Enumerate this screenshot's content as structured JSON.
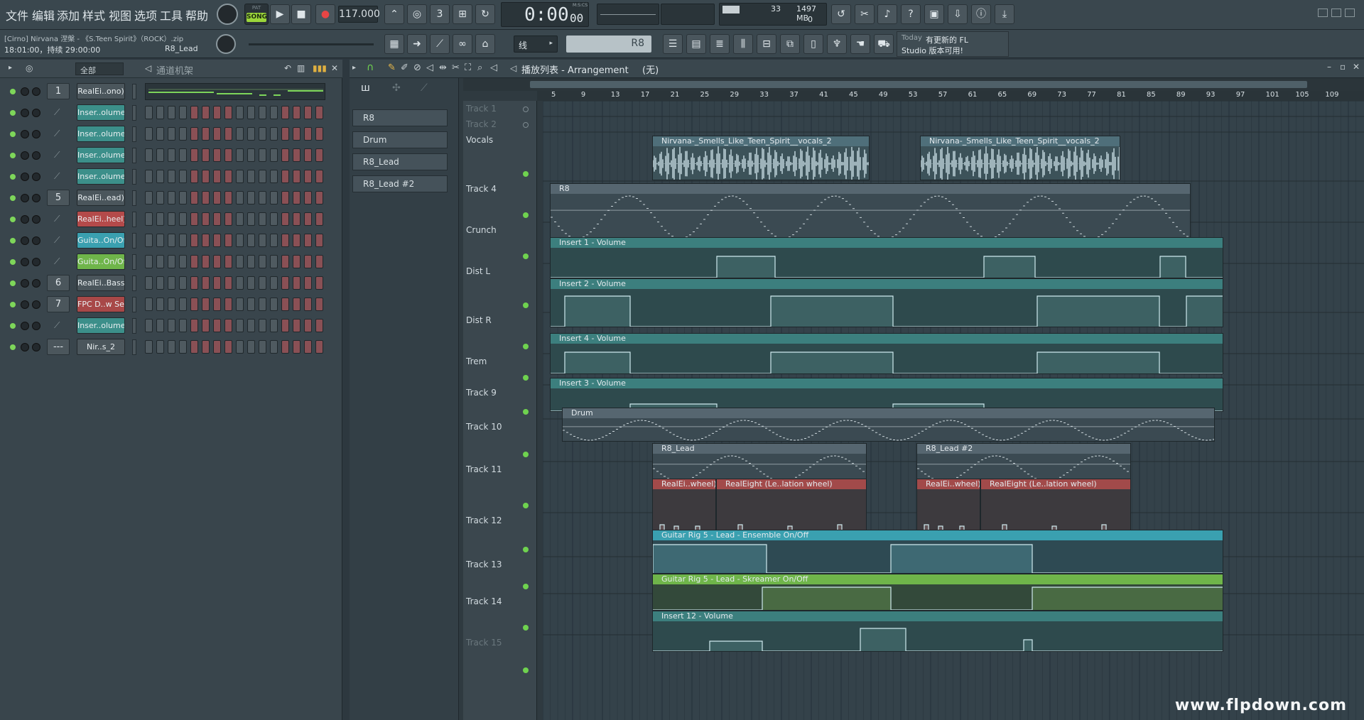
{
  "menu": {
    "items": [
      "文件",
      "编辑",
      "添加",
      "样式",
      "视图",
      "选项",
      "工具",
      "帮助"
    ]
  },
  "transport": {
    "mode_pat": "PAT",
    "mode_song": "SONG",
    "tempo": "117.000",
    "time": "0:00",
    "time_sub": "00",
    "time_unit": "M:S:CS"
  },
  "monitor": {
    "cpu_value": "33",
    "mem_value": "1497 MB",
    "poly_value": "0"
  },
  "project": {
    "title": "[Cirno] Nirvana 涅槃 - 《S.Teen Spirit》（ROCK）.zip",
    "time_info": "18:01:00，持续 29:00:00",
    "pattern_name": "R8_Lead"
  },
  "snap": {
    "value": "线"
  },
  "pattern_selector": {
    "value": "R8"
  },
  "news": {
    "today": "Today",
    "line1": "有更新的 FL",
    "line2": "Studio 版本可用!"
  },
  "channel_rack": {
    "filter": "全部",
    "title": "通道机架",
    "channels": [
      {
        "num": "1",
        "name": "RealEi..ono)",
        "color": "#4b565c"
      },
      {
        "num": "",
        "name": "Inser..olume",
        "color": "#3c8f8a"
      },
      {
        "num": "",
        "name": "Inser..olume",
        "color": "#3c8f8a"
      },
      {
        "num": "",
        "name": "Inser..olume",
        "color": "#3c8f8a"
      },
      {
        "num": "",
        "name": "Inser..olume",
        "color": "#3c8f8a"
      },
      {
        "num": "5",
        "name": "RealEi..ead)",
        "color": "#4b565c"
      },
      {
        "num": "",
        "name": "RealEi..heel)",
        "color": "#b44a4a"
      },
      {
        "num": "",
        "name": "Guita..On/Off",
        "color": "#3aa0b0"
      },
      {
        "num": "",
        "name": "Guita..On/Off",
        "color": "#6fb54a"
      },
      {
        "num": "6",
        "name": "RealEi..Bass)",
        "color": "#4b565c"
      },
      {
        "num": "7",
        "name": "FPC D..w Set",
        "color": "#a84848"
      },
      {
        "num": "",
        "name": "Inser..olume",
        "color": "#3c8f8a"
      },
      {
        "num": "---",
        "name": "Nir..s_2",
        "color": "#4b565c"
      }
    ]
  },
  "playlist": {
    "title": "播放列表 - Arrangement",
    "subtitle": "(无)",
    "patterns": [
      "R8",
      "Drum",
      "R8_Lead",
      "R8_Lead #2"
    ],
    "ruler": [
      "5",
      "9",
      "13",
      "17",
      "21",
      "25",
      "29",
      "33",
      "37",
      "41",
      "45",
      "49",
      "53",
      "57",
      "61",
      "65",
      "69",
      "73",
      "77",
      "81",
      "85",
      "89",
      "93",
      "97",
      "101",
      "105",
      "109"
    ],
    "tracks": [
      "Track 1",
      "Track 2",
      "Vocals",
      "Track 4",
      "Crunch",
      "Dist L",
      "Dist R",
      "Trem",
      "Track 9",
      "Track 10",
      "Track 11",
      "Track 12",
      "Track 13",
      "Track 14",
      "Track 15"
    ],
    "clips": {
      "vocals_1": "Nirvana-_Smells_Like_Teen_Spirit__vocals_2",
      "vocals_2": "Nirvana-_Smells_Like_Teen_Spirit__vocals_2",
      "track4": "R8",
      "crunch": "Insert 1 - Volume",
      "distl": "Insert 2 - Volume",
      "distr": "Insert 4 - Volume",
      "trem": "Insert 3 - Volume",
      "drum": "Drum",
      "lead1": "R8_Lead",
      "lead2": "R8_Lead #2",
      "wheel1a": "RealEi..wheel)",
      "wheel1b": "RealEight (Le..lation wheel)",
      "wheel2a": "RealEi..wheel)",
      "wheel2b": "RealEight (Le..lation wheel)",
      "t12": "Guitar Rig 5 - Lead - Ensemble On/Off",
      "t13": "Guitar Rig 5 - Lead - Skreamer On/Off",
      "t14": "Insert 12 - Volume"
    }
  },
  "watermark": "www.flpdown.com",
  "colors": {
    "accent_green": "#7ed65a",
    "teal": "#3c8f8a",
    "red": "#b44a4a"
  }
}
